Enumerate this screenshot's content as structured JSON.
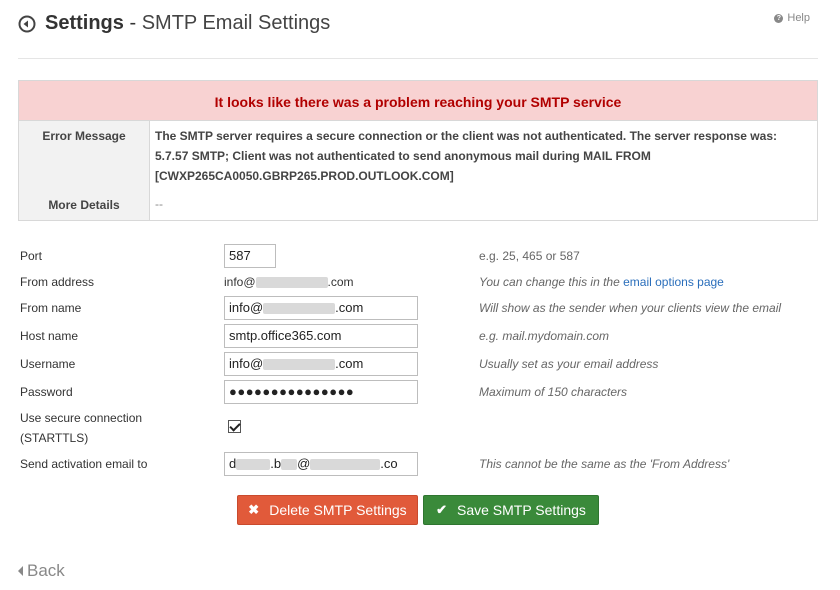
{
  "header": {
    "title_main": "Settings",
    "title_separator": " - ",
    "title_sub": "SMTP Email Settings",
    "help_label": "Help"
  },
  "error": {
    "heading": "It looks like there was a problem reaching your SMTP service",
    "message_label": "Error Message",
    "message": "The SMTP server requires a secure connection or the client was not authenticated. The server response was: 5.7.57 SMTP; Client was not authenticated to send anonymous mail during MAIL FROM [CWXP265CA0050.GBRP265.PROD.OUTLOOK.COM]",
    "details_label": "More Details",
    "details_value": "--"
  },
  "form": {
    "port": {
      "label": "Port",
      "value": "587",
      "hint": "e.g. 25, 465 or 587"
    },
    "from_address": {
      "label": "From address",
      "prefix": "info@",
      "suffix": ".com",
      "hint": "You can change this in the",
      "hint_link": "email options page"
    },
    "from_name": {
      "label": "From name",
      "prefix": "info@",
      "suffix": ".com",
      "hint": "Will show as the sender when your clients view the email"
    },
    "host_name": {
      "label": "Host name",
      "value": "smtp.office365.com",
      "hint": "e.g. mail.mydomain.com"
    },
    "username": {
      "label": "Username",
      "prefix": "info@",
      "suffix": ".com",
      "hint": "Usually set as your email address"
    },
    "password": {
      "label": "Password",
      "value": "●●●●●●●●●●●●●●●",
      "hint": "Maximum of 150 characters"
    },
    "secure": {
      "label_line1": "Use secure connection",
      "label_line2": "(STARTTLS)",
      "checked": true
    },
    "activation": {
      "label": "Send activation email to",
      "part1": "d",
      "part2": ".b",
      "part3": "@",
      "part4": ".co",
      "hint": "This cannot be the same as the 'From Address'"
    }
  },
  "buttons": {
    "delete_label": "Delete SMTP Settings",
    "save_label": "Save SMTP Settings"
  },
  "footer": {
    "back_label": "Back"
  }
}
